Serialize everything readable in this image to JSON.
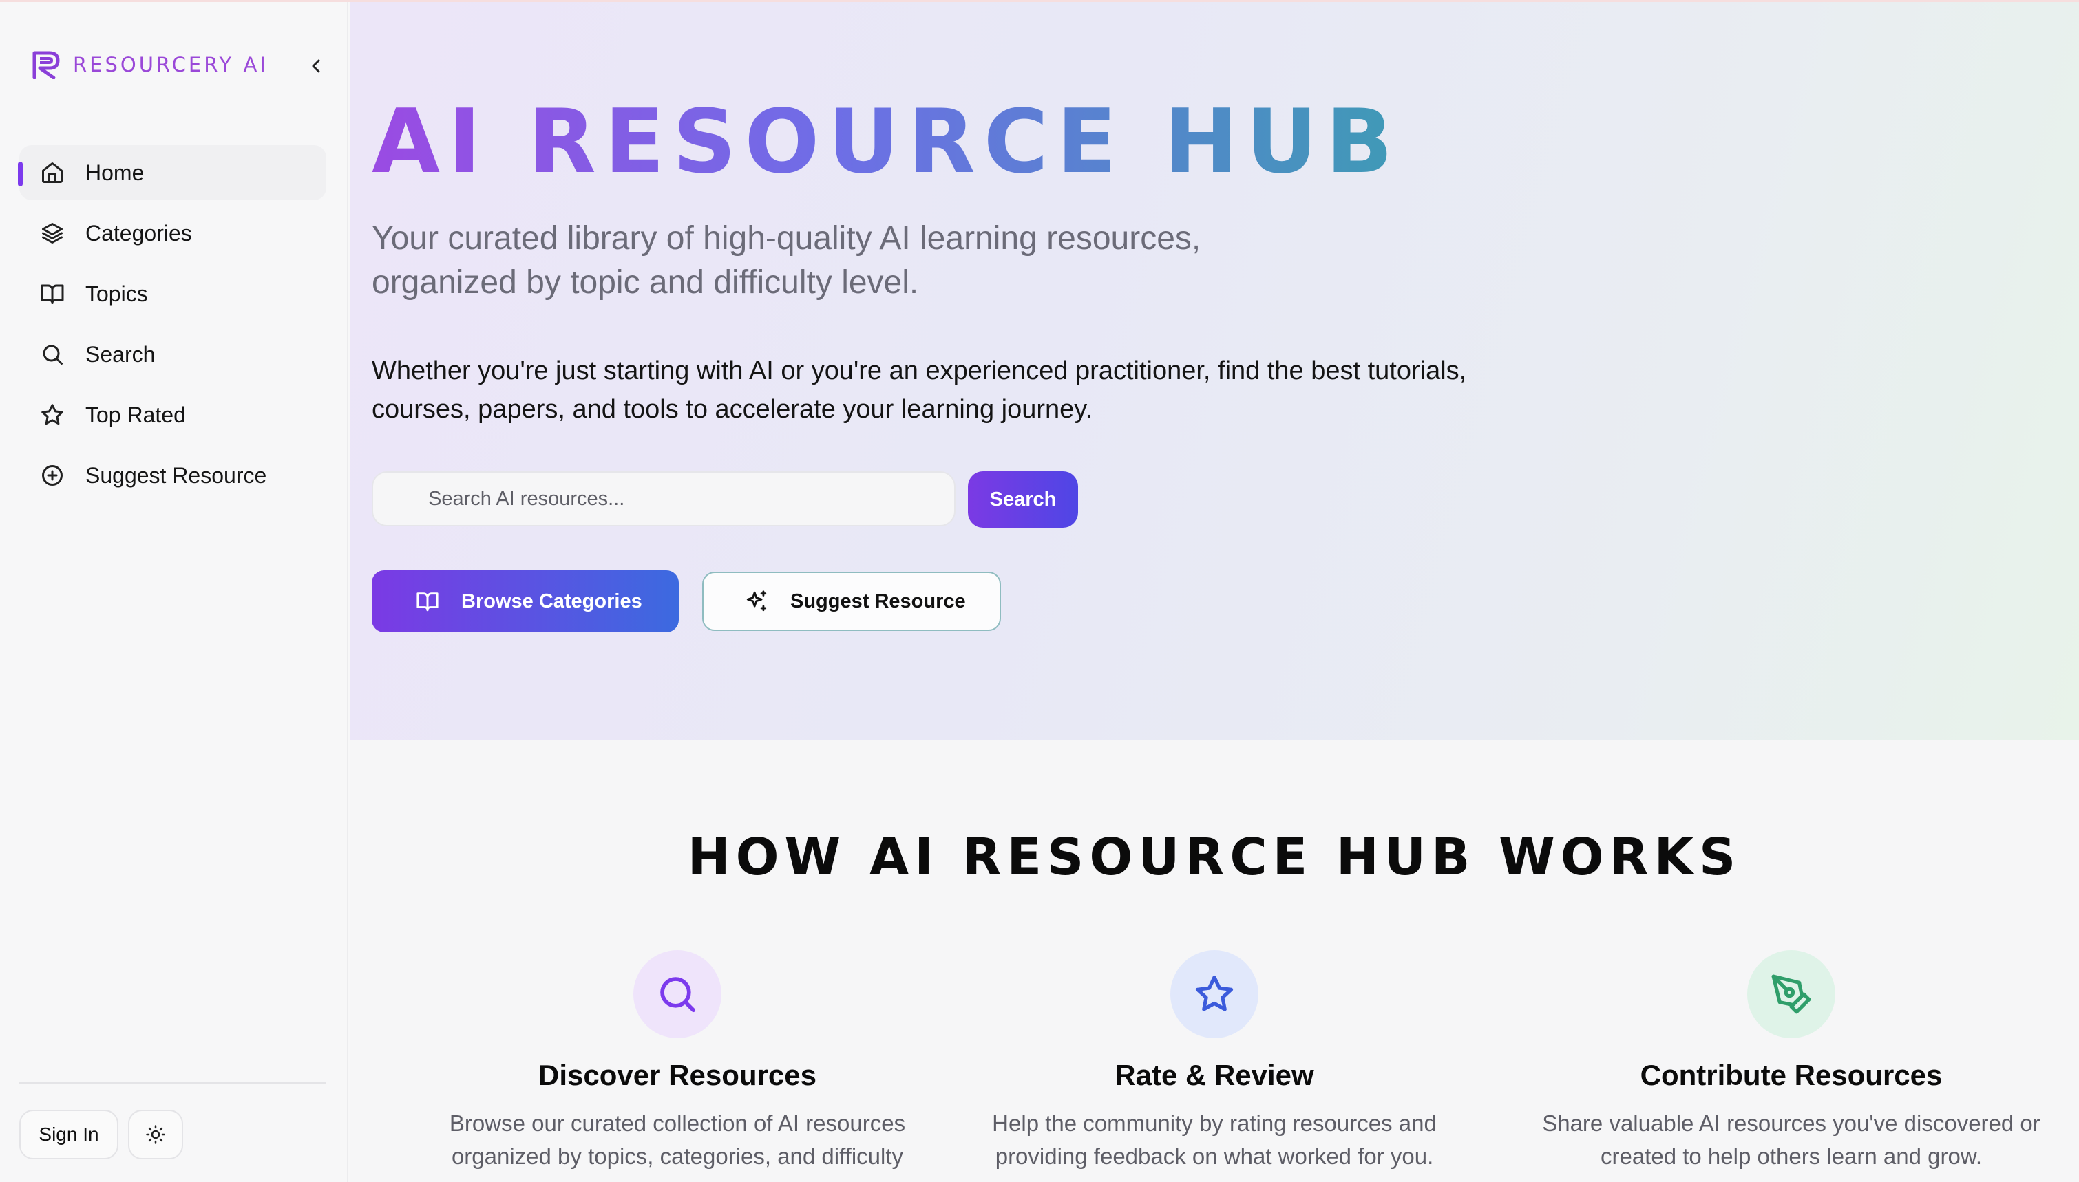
{
  "brand": {
    "name": "RESOURCERY AI"
  },
  "sidebar": {
    "items": [
      {
        "label": "Home",
        "icon": "home-icon",
        "active": true
      },
      {
        "label": "Categories",
        "icon": "layers-icon",
        "active": false
      },
      {
        "label": "Topics",
        "icon": "book-open-icon",
        "active": false
      },
      {
        "label": "Search",
        "icon": "search-icon",
        "active": false
      },
      {
        "label": "Top Rated",
        "icon": "star-icon",
        "active": false
      },
      {
        "label": "Suggest Resource",
        "icon": "plus-circle-icon",
        "active": false
      }
    ],
    "sign_in_label": "Sign In",
    "theme_icon": "sun-icon"
  },
  "hero": {
    "title": "AI RESOURCE HUB",
    "subtitle": "Your curated library of high-quality AI learning resources, organized by topic and difficulty level.",
    "description": "Whether you're just starting with AI or you're an experienced practitioner, find the best tutorials, courses, papers, and tools to accelerate your learning journey.",
    "search_placeholder": "Search AI resources...",
    "search_button": "Search",
    "browse_button": "Browse Categories",
    "suggest_button": "Suggest Resource"
  },
  "how": {
    "title": "HOW AI RESOURCE HUB WORKS",
    "features": [
      {
        "title": "Discover Resources",
        "text": "Browse our curated collection of AI resources organized by topics, categories, and difficulty",
        "icon": "search-icon",
        "color": "#7c3aed",
        "bg": "#efe4fb"
      },
      {
        "title": "Rate & Review",
        "text": "Help the community by rating resources and providing feedback on what worked for you.",
        "icon": "star-icon",
        "color": "#3b5bdb",
        "bg": "#e1e8fb"
      },
      {
        "title": "Contribute Resources",
        "text": "Share valuable AI resources you've discovered or created to help others learn and grow.",
        "icon": "pen-tool-icon",
        "color": "#2f9e6a",
        "bg": "#dff3e8"
      }
    ]
  },
  "colors": {
    "accent": "#7c3aed",
    "accent_blue": "#4f46e5",
    "brand": "#9a48d8"
  }
}
